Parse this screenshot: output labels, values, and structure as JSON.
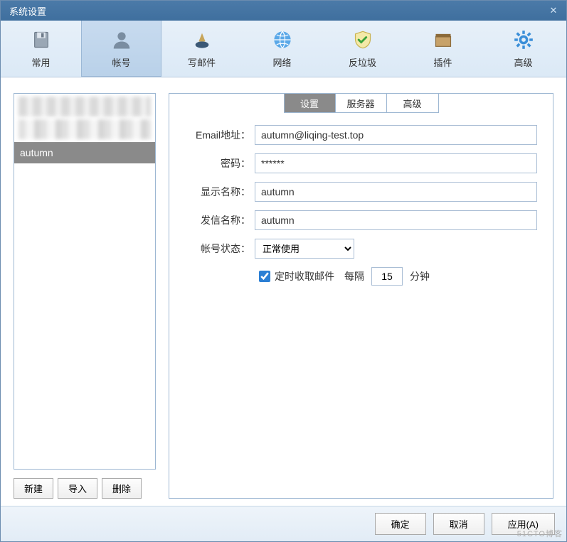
{
  "window": {
    "title": "系统设置"
  },
  "toolbar": {
    "items": [
      {
        "label": "常用",
        "icon": "floppy-icon"
      },
      {
        "label": "帐号",
        "icon": "person-icon",
        "active": true
      },
      {
        "label": "写邮件",
        "icon": "inkwell-icon"
      },
      {
        "label": "网络",
        "icon": "globe-icon"
      },
      {
        "label": "反垃圾",
        "icon": "shield-check-icon"
      },
      {
        "label": "插件",
        "icon": "box-icon"
      },
      {
        "label": "高级",
        "icon": "gear-icon"
      }
    ]
  },
  "accounts": {
    "items": [
      {
        "label": "（已隐去）",
        "blurred": true
      },
      {
        "label": "（已隐去）",
        "blurred": true
      },
      {
        "label": "autumn",
        "selected": true
      }
    ],
    "buttons": {
      "new": "新建",
      "import": "导入",
      "delete": "删除"
    }
  },
  "subtabs": {
    "items": [
      {
        "label": "设置",
        "active": true
      },
      {
        "label": "服务器"
      },
      {
        "label": "高级"
      }
    ]
  },
  "form": {
    "email_label": "Email地址：",
    "email_value": "autumn@liqing-test.top",
    "password_label": "密码：",
    "password_value": "******",
    "display_name_label": "显示名称：",
    "display_name_value": "autumn",
    "sender_name_label": "发信名称：",
    "sender_name_value": "autumn",
    "status_label": "帐号状态：",
    "status_value": "正常使用",
    "status_options": [
      "正常使用"
    ],
    "schedule_checked": true,
    "schedule_label": "定时收取邮件",
    "interval_prefix": "每隔",
    "interval_value": "15",
    "interval_suffix": "分钟"
  },
  "footer": {
    "ok": "确定",
    "cancel": "取消",
    "apply": "应用(A)"
  },
  "watermark": "51CTO博客"
}
